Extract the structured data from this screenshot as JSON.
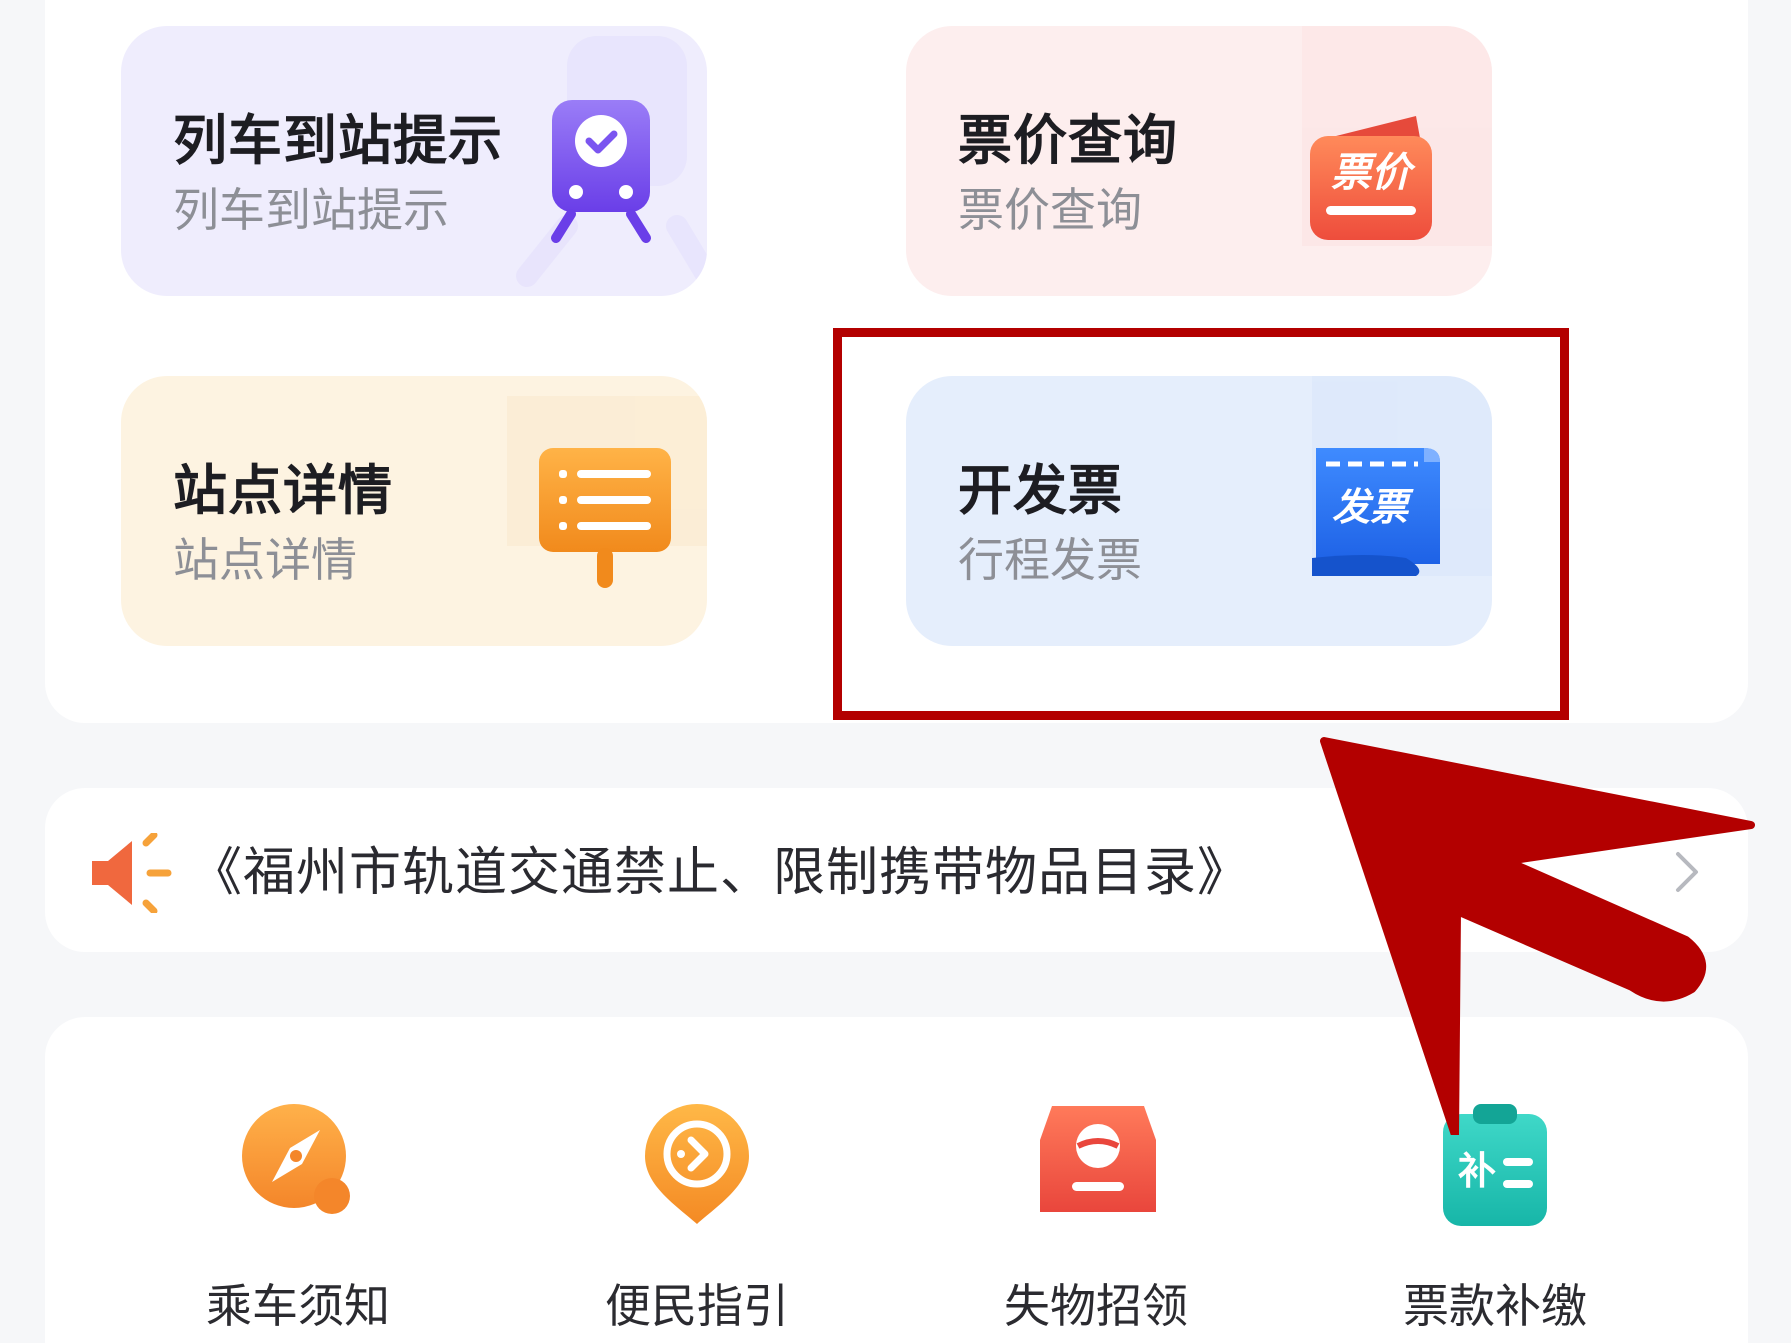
{
  "cards": {
    "arrival": {
      "title": "列车到站提示",
      "subtitle": "列车到站提示",
      "icon": "train-check-icon"
    },
    "fare": {
      "title": "票价查询",
      "subtitle": "票价查询",
      "icon": "ticket-price-icon",
      "icon_text": "票价"
    },
    "station": {
      "title": "站点详情",
      "subtitle": "站点详情",
      "icon": "signboard-list-icon"
    },
    "invoice": {
      "title": "开发票",
      "subtitle": "行程发票",
      "icon": "invoice-scroll-icon",
      "icon_text": "发票"
    }
  },
  "notice": {
    "text": "《福州市轨道交通禁止、限制携带物品目录》",
    "icon": "speaker-icon"
  },
  "tools": [
    {
      "label": "乘车须知",
      "icon": "compass-icon"
    },
    {
      "label": "便民指引",
      "icon": "location-arrow-icon"
    },
    {
      "label": "失物招领",
      "icon": "lost-box-icon"
    },
    {
      "label": "票款补缴",
      "icon": "clipboard-supplement-icon",
      "icon_text": "补"
    }
  ],
  "colors": {
    "highlight": "#b30000",
    "arrival_bg": "#efedfd",
    "fare_bg": "#fdeeee",
    "station_bg": "#fdf3e1",
    "invoice_bg": "#e5eefc"
  }
}
